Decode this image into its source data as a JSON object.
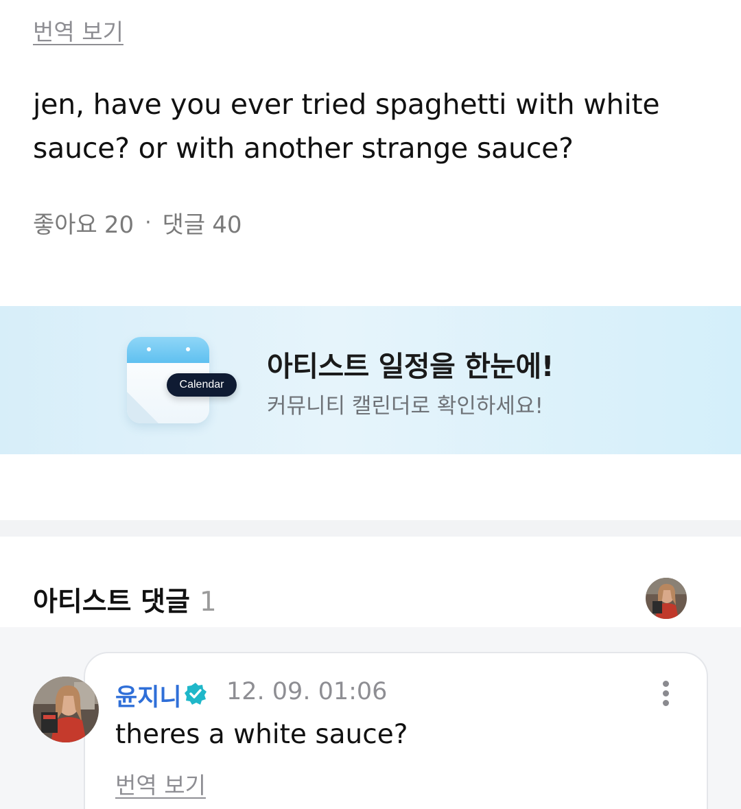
{
  "post": {
    "translate_label": "번역 보기",
    "body": "jen, have you ever tried spaghetti with white sauce? or with another strange sauce?",
    "likes_label": "좋아요",
    "likes_count": "20",
    "separator": "·",
    "comments_label": "댓글",
    "comments_count": "40"
  },
  "banner": {
    "calendar_badge": "Calendar",
    "title": "아티스트 일정을 한눈에!",
    "subtitle": "커뮤니티 캘린더로 확인하세요!",
    "accent_color": "#5fc0f0"
  },
  "artist_comments": {
    "header_label": "아티스트 댓글",
    "count": "1",
    "comments": [
      {
        "author": "윤지니",
        "verified_icon": "verified-badge-icon",
        "timestamp": "12. 09. 01:06",
        "text": "theres a white sauce?",
        "translate_label": "번역 보기"
      }
    ]
  },
  "colors": {
    "author_blue": "#2f6fd8",
    "verified_teal": "#1fb7c9",
    "muted_text": "#8e8e93"
  }
}
